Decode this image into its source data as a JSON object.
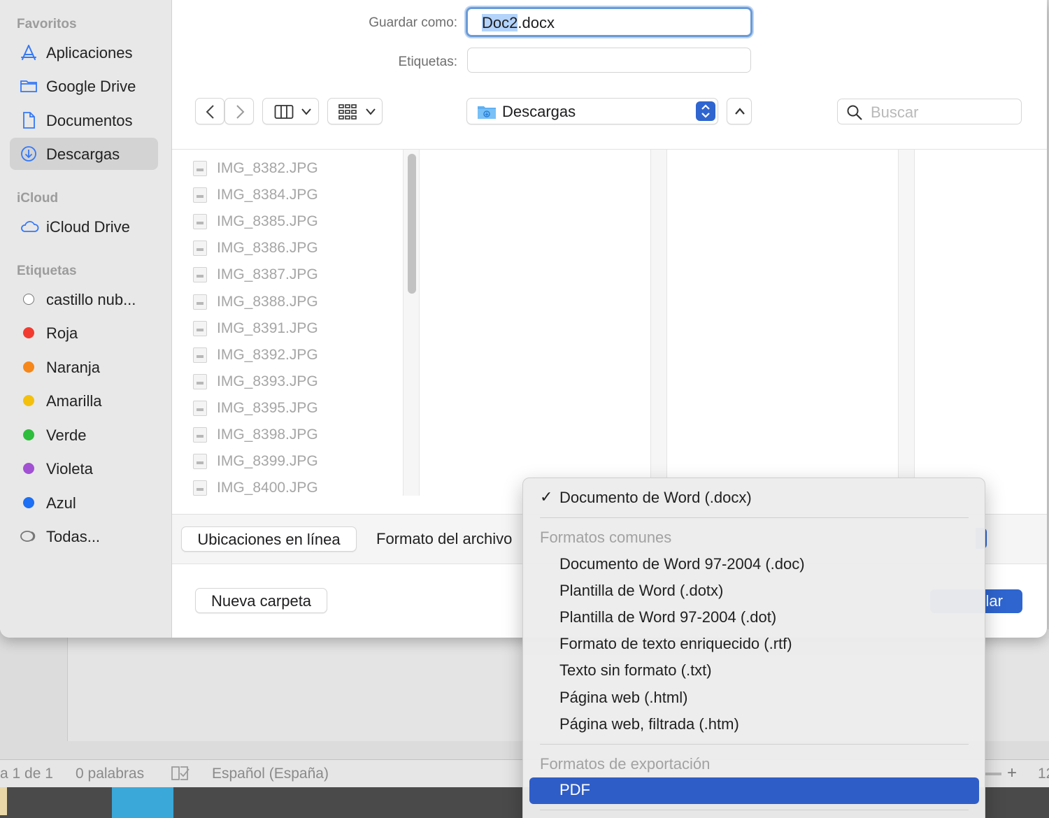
{
  "dialog": {
    "save_as_label": "Guardar como:",
    "filename_selected": "Doc2",
    "filename_ext": ".docx",
    "tags_label": "Etiquetas:",
    "location": "Descargas",
    "search_placeholder": "Buscar"
  },
  "sidebar": {
    "favorites_header": "Favoritos",
    "favorites": [
      {
        "label": "Aplicaciones",
        "icon": "applications-icon"
      },
      {
        "label": "Google Drive",
        "icon": "folder-icon"
      },
      {
        "label": "Documentos",
        "icon": "document-icon"
      },
      {
        "label": "Descargas",
        "icon": "download-icon",
        "active": true
      }
    ],
    "icloud_header": "iCloud",
    "icloud": [
      {
        "label": "iCloud Drive",
        "icon": "cloud-icon"
      }
    ],
    "tags_header": "Etiquetas",
    "tags": [
      {
        "label": "castillo nub...",
        "color": "#ffffff"
      },
      {
        "label": "Roja",
        "color": "#f23b30"
      },
      {
        "label": "Naranja",
        "color": "#f6871a"
      },
      {
        "label": "Amarilla",
        "color": "#f4c00e"
      },
      {
        "label": "Verde",
        "color": "#2ebd3c"
      },
      {
        "label": "Violeta",
        "color": "#a151d2"
      },
      {
        "label": "Azul",
        "color": "#1d6ff3"
      },
      {
        "label": "Todas...",
        "color": "all-tags"
      }
    ]
  },
  "files": [
    "IMG_8382.JPG",
    "IMG_8384.JPG",
    "IMG_8385.JPG",
    "IMG_8386.JPG",
    "IMG_8387.JPG",
    "IMG_8388.JPG",
    "IMG_8391.JPG",
    "IMG_8392.JPG",
    "IMG_8393.JPG",
    "IMG_8395.JPG",
    "IMG_8398.JPG",
    "IMG_8399.JPG",
    "IMG_8400.JPG"
  ],
  "options": {
    "online_locations": "Ubicaciones en línea",
    "file_format_label": "Formato del archivo",
    "new_folder": "Nueva carpeta",
    "save_button_partial": "lar"
  },
  "format_menu": {
    "selected": "Documento de Word (.docx)",
    "common_header": "Formatos comunes",
    "common": [
      "Documento de Word 97-2004 (.doc)",
      "Plantilla de Word (.dotx)",
      "Plantilla de Word 97-2004 (.dot)",
      "Formato de texto enriquecido (.rtf)",
      "Texto sin formato (.txt)",
      "Página web (.html)",
      "Página web, filtrada (.htm)"
    ],
    "export_header": "Formatos de exportación",
    "highlighted": "PDF"
  },
  "statusbar": {
    "page": "a 1 de 1",
    "words": "0 palabras",
    "language": "Español (España)",
    "zoom_plus": "+",
    "zoom_partial": "12"
  },
  "colors": {
    "accent": "#2f65cf",
    "menu_highlight": "#2f5dc8"
  }
}
